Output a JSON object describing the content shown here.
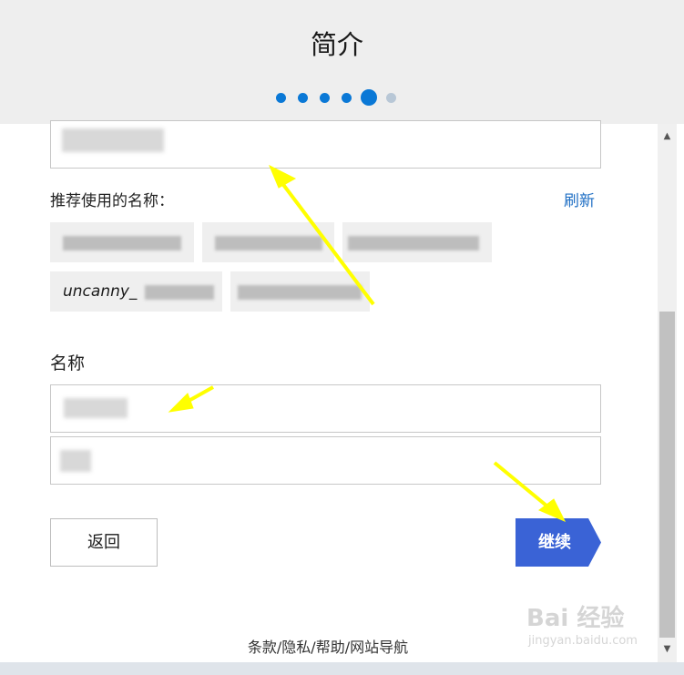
{
  "header": {
    "title": "简介",
    "steps_total": 6,
    "current_step": 5
  },
  "suggestions": {
    "label": "推荐使用的名称：",
    "refresh_label": "刷新",
    "chips": [
      "uncanny_",
      "",
      "",
      "",
      ""
    ]
  },
  "name_section": {
    "label": "名称"
  },
  "actions": {
    "back_label": "返回",
    "next_label": "继续"
  },
  "footer": {
    "links": [
      "条款",
      "隐私",
      "帮助",
      "网站导航"
    ],
    "separator": "/"
  },
  "watermark": {
    "brand": "Bai 经验",
    "domain": "jingyan.baidu.com"
  },
  "colors": {
    "accent": "#3a63d6",
    "dot": "#0a78d6",
    "annotation": "#ffff00"
  }
}
